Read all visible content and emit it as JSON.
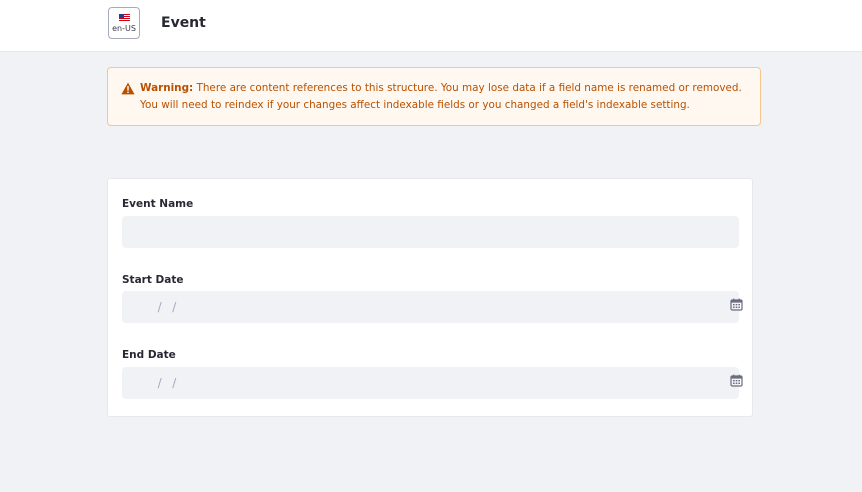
{
  "header": {
    "locale": {
      "label": "en-US",
      "icon": "us-flag-icon"
    },
    "title": "Event"
  },
  "alert": {
    "icon": "warning-triangle-icon",
    "title": "Warning:",
    "message": "There are content references to this structure. You may lose data if a field name is renamed or removed. You will need to reindex if your changes affect indexable fields or you changed a field's indexable setting.",
    "colors": {
      "text": "#b95000",
      "background": "#fff8f0",
      "border": "#f6c68f"
    }
  },
  "form": {
    "fields": [
      {
        "label": "Event Name",
        "value": ""
      },
      {
        "label": "Start Date",
        "placeholder": "  /  /",
        "icon": "calendar-icon"
      },
      {
        "label": "End Date",
        "placeholder": "  /  /",
        "icon": "calendar-icon"
      }
    ]
  }
}
